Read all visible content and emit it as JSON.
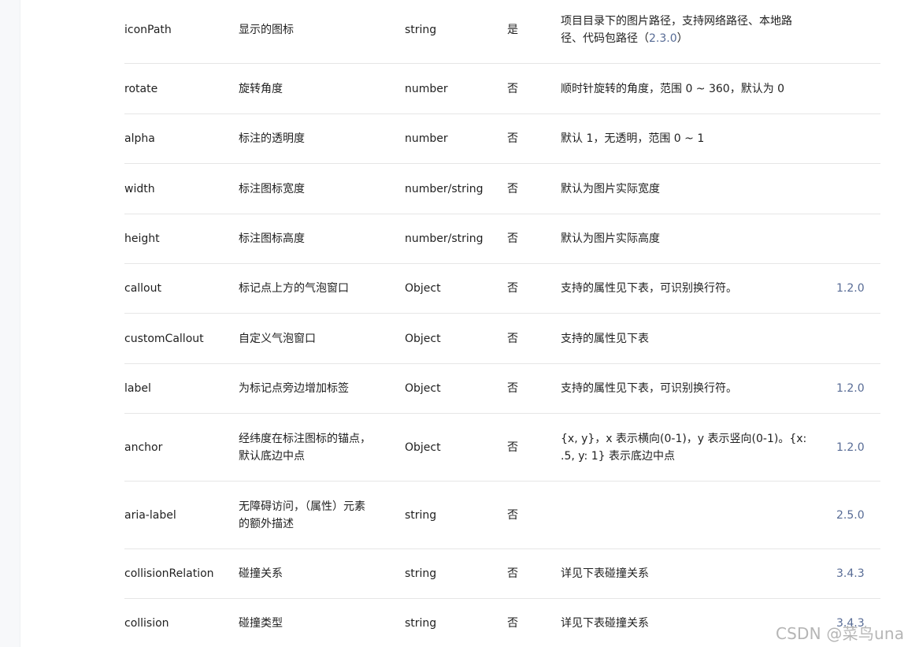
{
  "rows": [
    {
      "name": "iconPath",
      "desc": "显示的图标",
      "type": "string",
      "required": "是",
      "note": "项目目录下的图片路径，支持网络路径、本地路径、代码包路径（",
      "note_link": "2.3.0",
      "note_tail": "）",
      "version": ""
    },
    {
      "name": "rotate",
      "desc": "旋转角度",
      "type": "number",
      "required": "否",
      "note": "顺时针旋转的角度，范围 0 ~ 360，默认为 0",
      "version": ""
    },
    {
      "name": "alpha",
      "desc": "标注的透明度",
      "type": "number",
      "required": "否",
      "note": "默认 1，无透明，范围 0 ~ 1",
      "version": ""
    },
    {
      "name": "width",
      "desc": "标注图标宽度",
      "type": "number/string",
      "required": "否",
      "note": "默认为图片实际宽度",
      "version": ""
    },
    {
      "name": "height",
      "desc": "标注图标高度",
      "type": "number/string",
      "required": "否",
      "note": "默认为图片实际高度",
      "version": ""
    },
    {
      "name": "callout",
      "desc": "标记点上方的气泡窗口",
      "type": "Object",
      "required": "否",
      "note": "支持的属性见下表，可识别换行符。",
      "version": "1.2.0"
    },
    {
      "name": "customCallout",
      "desc": "自定义气泡窗口",
      "type": "Object",
      "required": "否",
      "note": "支持的属性见下表",
      "version": ""
    },
    {
      "name": "label",
      "desc": "为标记点旁边增加标签",
      "type": "Object",
      "required": "否",
      "note": "支持的属性见下表，可识别换行符。",
      "version": "1.2.0"
    },
    {
      "name": "anchor",
      "desc": "经纬度在标注图标的锚点，默认底边中点",
      "type": "Object",
      "required": "否",
      "note": "{x, y}，x 表示横向(0-1)，y 表示竖向(0-1)。{x: .5, y: 1} 表示底边中点",
      "version": "1.2.0"
    },
    {
      "name": "aria-label",
      "desc": "无障碍访问，（属性）元素的额外描述",
      "type": "string",
      "required": "否",
      "note": "",
      "version": "2.5.0"
    },
    {
      "name": "collisionRelation",
      "desc": "碰撞关系",
      "type": "string",
      "required": "否",
      "note": "详见下表碰撞关系",
      "version": "3.4.3"
    },
    {
      "name": "collision",
      "desc": "碰撞类型",
      "type": "string",
      "required": "否",
      "note": "详见下表碰撞关系",
      "version": "3.4.3"
    }
  ],
  "watermark": "CSDN @菜鸟una"
}
